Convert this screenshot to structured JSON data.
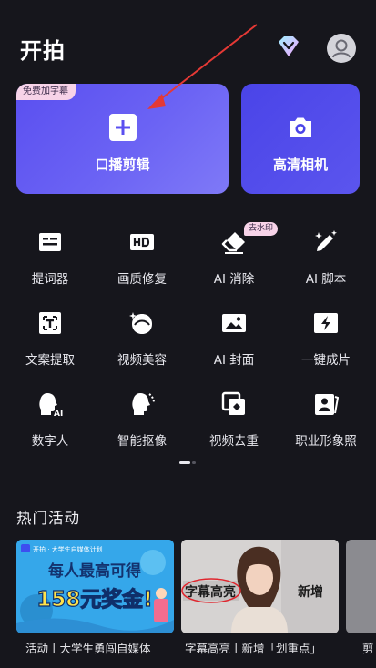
{
  "header": {
    "title": "开拍",
    "vip_icon": "diamond-icon",
    "avatar_icon": "user-avatar-icon"
  },
  "cards": {
    "main": {
      "badge": "免费加字幕",
      "label": "口播剪辑",
      "icon": "plus-icon"
    },
    "camera": {
      "label": "高清相机",
      "icon": "camera-icon"
    }
  },
  "tools": [
    {
      "label": "提词器",
      "icon": "teleprompter-icon"
    },
    {
      "label": "画质修复",
      "icon": "hd-icon"
    },
    {
      "label": "AI 消除",
      "icon": "eraser-icon",
      "badge": "去水印"
    },
    {
      "label": "AI 脚本",
      "icon": "magic-pen-icon"
    },
    {
      "label": "文案提取",
      "icon": "text-extract-icon"
    },
    {
      "label": "视频美容",
      "icon": "beauty-icon"
    },
    {
      "label": "AI 封面",
      "icon": "image-icon"
    },
    {
      "label": "一键成片",
      "icon": "lightning-icon"
    },
    {
      "label": "数字人",
      "icon": "digital-human-icon"
    },
    {
      "label": "智能抠像",
      "icon": "cutout-icon"
    },
    {
      "label": "视频去重",
      "icon": "dedupe-icon"
    },
    {
      "label": "职业形象照",
      "icon": "portrait-icon"
    }
  ],
  "activities": {
    "section_title": "热门活动",
    "items": [
      {
        "caption": "活动丨大学生勇闯自媒体",
        "banner_top": "开拍 · 大学生自媒体计划",
        "banner_headline": "每人最高可得",
        "banner_amount": "158元奖金!"
      },
      {
        "caption": "字幕高亮丨新增「划重点」",
        "tag_left": "字幕高亮",
        "tag_right": "新增"
      },
      {
        "caption": "剪"
      }
    ]
  },
  "colors": {
    "background": "#16161c",
    "card_main": "#5a4ff0",
    "card_camera": "#4a44e8",
    "badge_bg": "#f7d3e8",
    "annotation_arrow": "#e53935"
  }
}
